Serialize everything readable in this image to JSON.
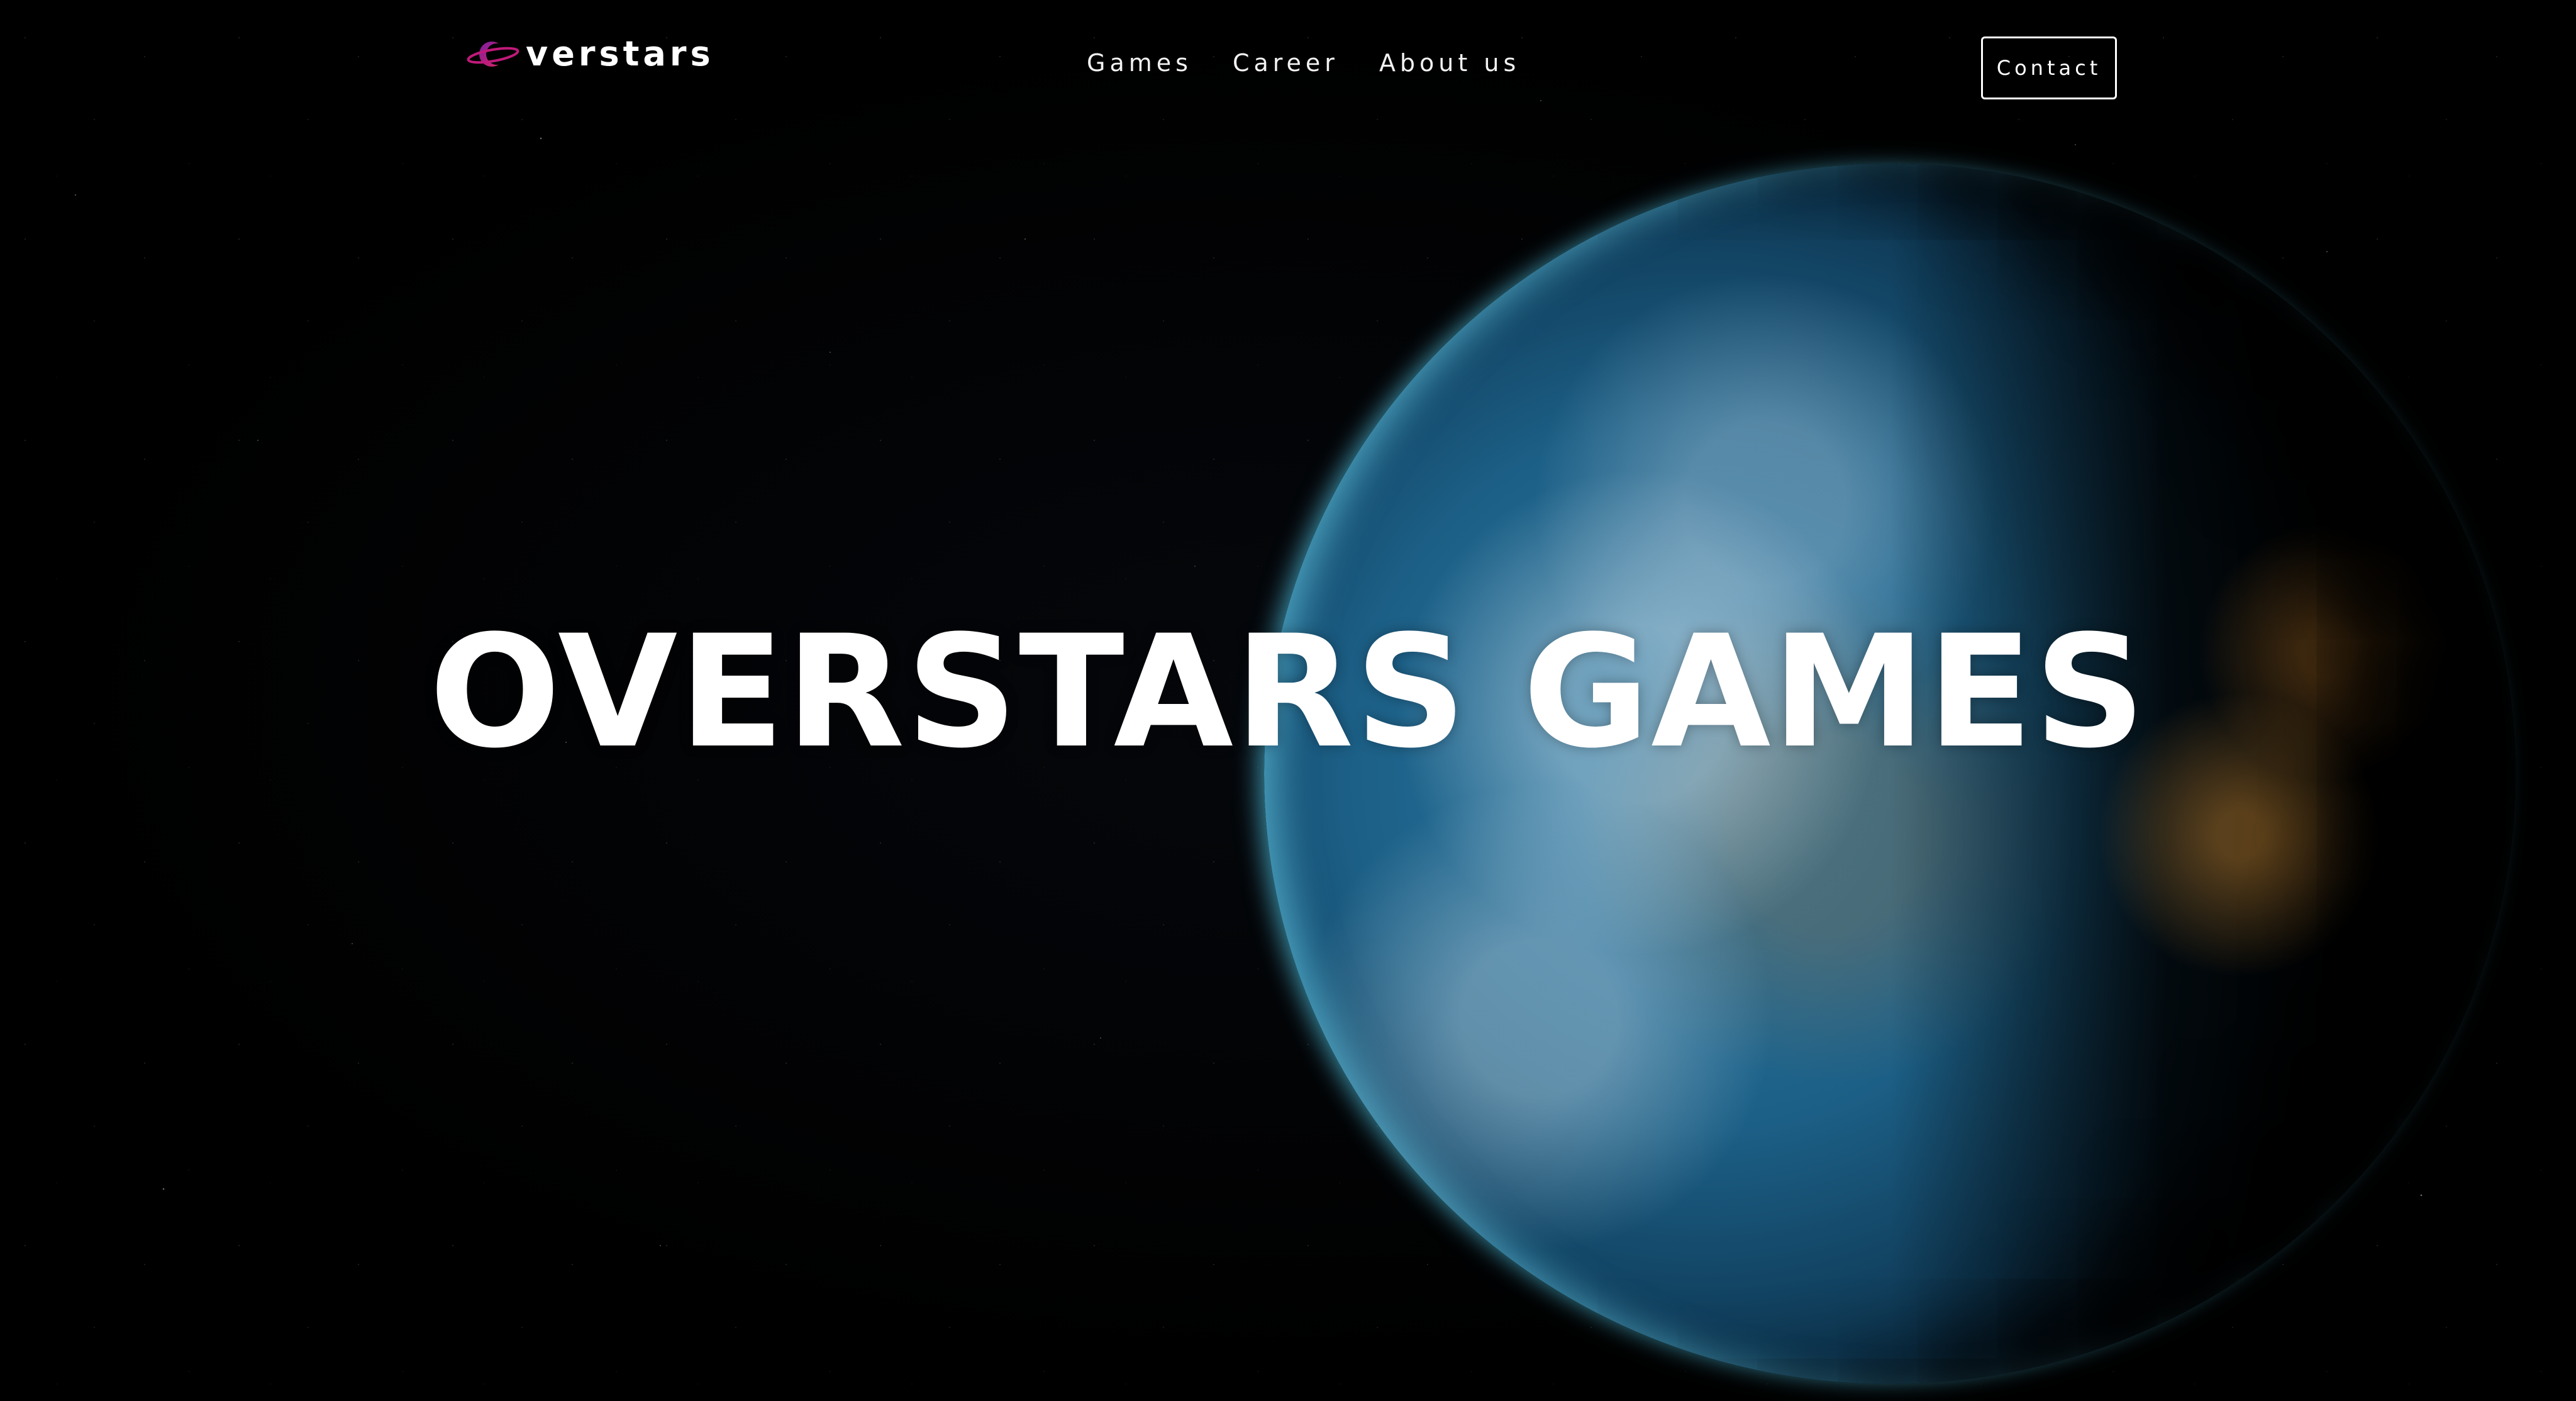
{
  "header": {
    "logo_text": "verstars",
    "nav": [
      {
        "label": "Games"
      },
      {
        "label": "Career"
      },
      {
        "label": "About us"
      }
    ],
    "contact_label": "Contact"
  },
  "hero": {
    "title": "OVERSTARS GAMES"
  },
  "colors": {
    "background": "#000000",
    "text": "#ffffff",
    "logo_accent_1": "#7a1fa2",
    "logo_accent_2": "#e0245e",
    "planet_ocean": "#1c5f86",
    "planet_glow": "#5adcff"
  }
}
